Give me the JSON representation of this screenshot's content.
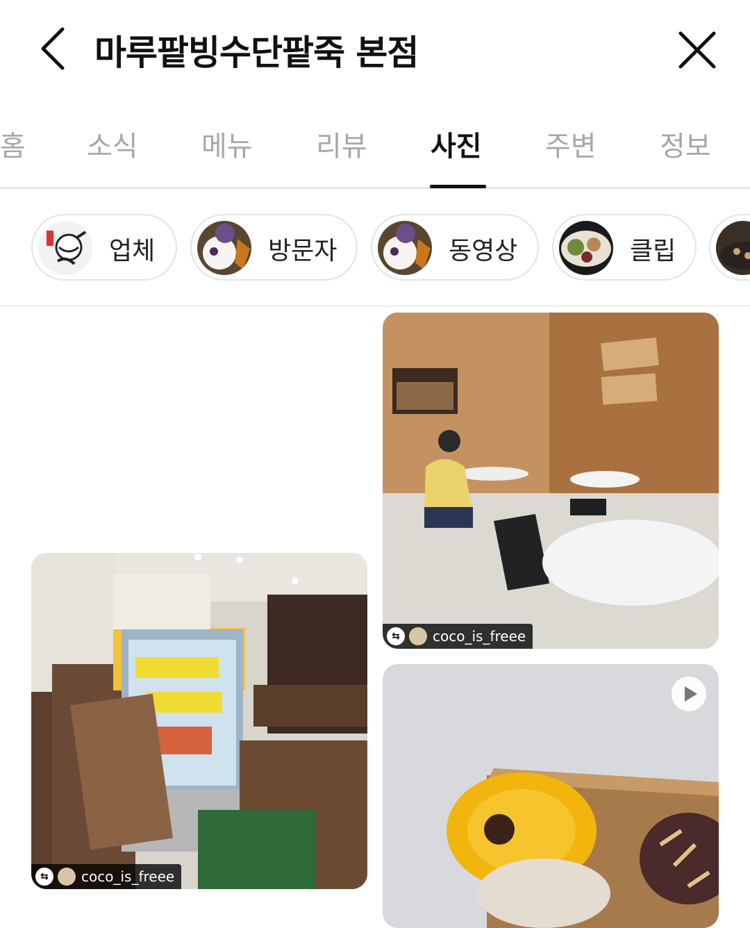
{
  "header": {
    "title": "마루팥빙수단팥죽 본점",
    "back_icon": "chevron-left-icon",
    "close_icon": "close-icon"
  },
  "tabs": {
    "items": [
      "홈",
      "소식",
      "메뉴",
      "리뷰",
      "사진",
      "주변",
      "정보"
    ],
    "active": "사진"
  },
  "chips": [
    {
      "label": "업체"
    },
    {
      "label": "방문자"
    },
    {
      "label": "동영상"
    },
    {
      "label": "클립"
    }
  ],
  "photos": [
    {
      "author": "coco_is_freee"
    },
    {
      "author": "coco_is_freee"
    },
    {
      "author": "",
      "is_video": true
    }
  ],
  "colors": {
    "tab_inactive": "#a7a7a7",
    "tab_active": "#111111",
    "chip_border": "#e3e3e3"
  }
}
